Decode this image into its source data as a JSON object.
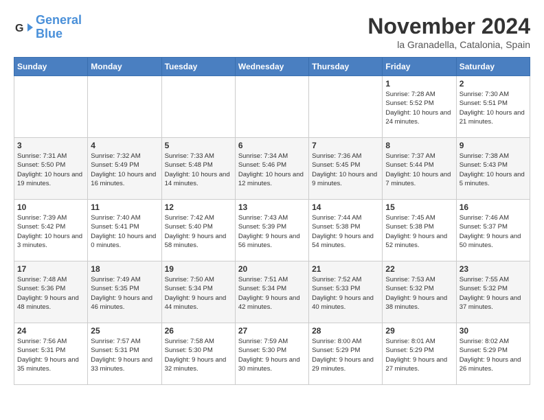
{
  "header": {
    "logo_line1": "General",
    "logo_line2": "Blue",
    "title": "November 2024",
    "location": "la Granadella, Catalonia, Spain"
  },
  "days_of_week": [
    "Sunday",
    "Monday",
    "Tuesday",
    "Wednesday",
    "Thursday",
    "Friday",
    "Saturday"
  ],
  "weeks": [
    [
      {
        "day": "",
        "info": ""
      },
      {
        "day": "",
        "info": ""
      },
      {
        "day": "",
        "info": ""
      },
      {
        "day": "",
        "info": ""
      },
      {
        "day": "",
        "info": ""
      },
      {
        "day": "1",
        "info": "Sunrise: 7:28 AM\nSunset: 5:52 PM\nDaylight: 10 hours and 24 minutes."
      },
      {
        "day": "2",
        "info": "Sunrise: 7:30 AM\nSunset: 5:51 PM\nDaylight: 10 hours and 21 minutes."
      }
    ],
    [
      {
        "day": "3",
        "info": "Sunrise: 7:31 AM\nSunset: 5:50 PM\nDaylight: 10 hours and 19 minutes."
      },
      {
        "day": "4",
        "info": "Sunrise: 7:32 AM\nSunset: 5:49 PM\nDaylight: 10 hours and 16 minutes."
      },
      {
        "day": "5",
        "info": "Sunrise: 7:33 AM\nSunset: 5:48 PM\nDaylight: 10 hours and 14 minutes."
      },
      {
        "day": "6",
        "info": "Sunrise: 7:34 AM\nSunset: 5:46 PM\nDaylight: 10 hours and 12 minutes."
      },
      {
        "day": "7",
        "info": "Sunrise: 7:36 AM\nSunset: 5:45 PM\nDaylight: 10 hours and 9 minutes."
      },
      {
        "day": "8",
        "info": "Sunrise: 7:37 AM\nSunset: 5:44 PM\nDaylight: 10 hours and 7 minutes."
      },
      {
        "day": "9",
        "info": "Sunrise: 7:38 AM\nSunset: 5:43 PM\nDaylight: 10 hours and 5 minutes."
      }
    ],
    [
      {
        "day": "10",
        "info": "Sunrise: 7:39 AM\nSunset: 5:42 PM\nDaylight: 10 hours and 3 minutes."
      },
      {
        "day": "11",
        "info": "Sunrise: 7:40 AM\nSunset: 5:41 PM\nDaylight: 10 hours and 0 minutes."
      },
      {
        "day": "12",
        "info": "Sunrise: 7:42 AM\nSunset: 5:40 PM\nDaylight: 9 hours and 58 minutes."
      },
      {
        "day": "13",
        "info": "Sunrise: 7:43 AM\nSunset: 5:39 PM\nDaylight: 9 hours and 56 minutes."
      },
      {
        "day": "14",
        "info": "Sunrise: 7:44 AM\nSunset: 5:38 PM\nDaylight: 9 hours and 54 minutes."
      },
      {
        "day": "15",
        "info": "Sunrise: 7:45 AM\nSunset: 5:38 PM\nDaylight: 9 hours and 52 minutes."
      },
      {
        "day": "16",
        "info": "Sunrise: 7:46 AM\nSunset: 5:37 PM\nDaylight: 9 hours and 50 minutes."
      }
    ],
    [
      {
        "day": "17",
        "info": "Sunrise: 7:48 AM\nSunset: 5:36 PM\nDaylight: 9 hours and 48 minutes."
      },
      {
        "day": "18",
        "info": "Sunrise: 7:49 AM\nSunset: 5:35 PM\nDaylight: 9 hours and 46 minutes."
      },
      {
        "day": "19",
        "info": "Sunrise: 7:50 AM\nSunset: 5:34 PM\nDaylight: 9 hours and 44 minutes."
      },
      {
        "day": "20",
        "info": "Sunrise: 7:51 AM\nSunset: 5:34 PM\nDaylight: 9 hours and 42 minutes."
      },
      {
        "day": "21",
        "info": "Sunrise: 7:52 AM\nSunset: 5:33 PM\nDaylight: 9 hours and 40 minutes."
      },
      {
        "day": "22",
        "info": "Sunrise: 7:53 AM\nSunset: 5:32 PM\nDaylight: 9 hours and 38 minutes."
      },
      {
        "day": "23",
        "info": "Sunrise: 7:55 AM\nSunset: 5:32 PM\nDaylight: 9 hours and 37 minutes."
      }
    ],
    [
      {
        "day": "24",
        "info": "Sunrise: 7:56 AM\nSunset: 5:31 PM\nDaylight: 9 hours and 35 minutes."
      },
      {
        "day": "25",
        "info": "Sunrise: 7:57 AM\nSunset: 5:31 PM\nDaylight: 9 hours and 33 minutes."
      },
      {
        "day": "26",
        "info": "Sunrise: 7:58 AM\nSunset: 5:30 PM\nDaylight: 9 hours and 32 minutes."
      },
      {
        "day": "27",
        "info": "Sunrise: 7:59 AM\nSunset: 5:30 PM\nDaylight: 9 hours and 30 minutes."
      },
      {
        "day": "28",
        "info": "Sunrise: 8:00 AM\nSunset: 5:29 PM\nDaylight: 9 hours and 29 minutes."
      },
      {
        "day": "29",
        "info": "Sunrise: 8:01 AM\nSunset: 5:29 PM\nDaylight: 9 hours and 27 minutes."
      },
      {
        "day": "30",
        "info": "Sunrise: 8:02 AM\nSunset: 5:29 PM\nDaylight: 9 hours and 26 minutes."
      }
    ]
  ]
}
